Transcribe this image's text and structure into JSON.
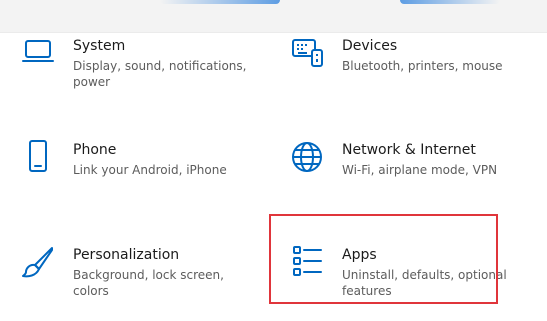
{
  "tiles": [
    {
      "id": "system",
      "title": "System",
      "description": "Display, sound, notifications, power",
      "icon": "laptop-icon"
    },
    {
      "id": "devices",
      "title": "Devices",
      "description": "Bluetooth, printers, mouse",
      "icon": "keyboard-icon"
    },
    {
      "id": "phone",
      "title": "Phone",
      "description": "Link your Android, iPhone",
      "icon": "phone-icon"
    },
    {
      "id": "network",
      "title": "Network & Internet",
      "description": "Wi-Fi, airplane mode, VPN",
      "icon": "globe-icon"
    },
    {
      "id": "personalization",
      "title": "Personalization",
      "description": "Background, lock screen, colors",
      "icon": "brush-icon"
    },
    {
      "id": "apps",
      "title": "Apps",
      "description": "Uninstall, defaults, optional features",
      "icon": "apps-list-icon"
    }
  ],
  "highlight": {
    "target": "apps",
    "color": "#e0353b"
  },
  "colors": {
    "accent": "#0067c0",
    "title": "#1b1b1b",
    "description": "#5c5c5c"
  }
}
